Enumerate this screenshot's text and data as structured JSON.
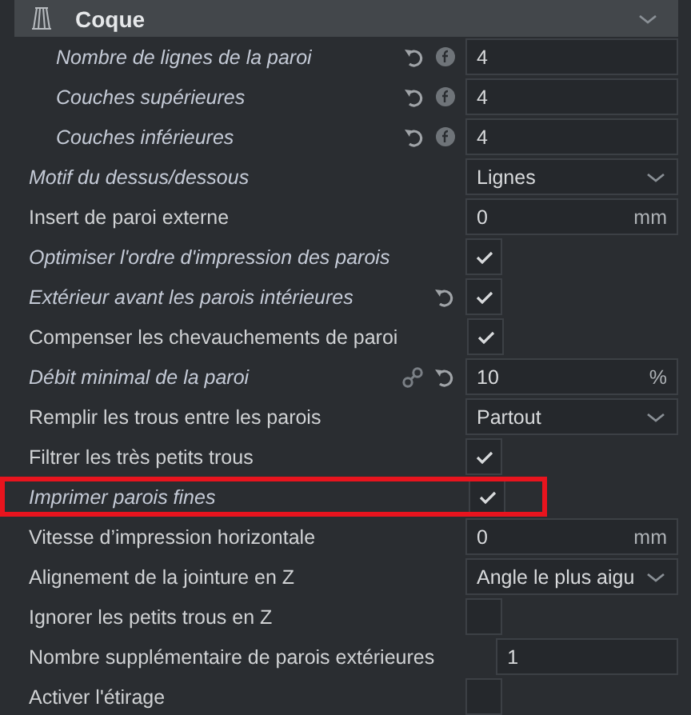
{
  "section": {
    "title": "Coque",
    "expanded": true
  },
  "rows": [
    {
      "label": "Nombre de lignes de la paroi",
      "kind": "number",
      "value": "4",
      "modified": true,
      "reset": true,
      "formula": true,
      "children": [
        {
          "label": "Couches supérieures",
          "kind": "number",
          "value": "4",
          "modified": true,
          "reset": true,
          "formula": true
        },
        {
          "label": "Couches inférieures",
          "kind": "number",
          "value": "4",
          "modified": true,
          "reset": true,
          "formula": true
        }
      ]
    },
    {
      "label": "Motif du dessus/dessous",
      "kind": "dropdown",
      "value": "Lignes",
      "modified": true
    },
    {
      "label": "Insert de paroi externe",
      "kind": "number",
      "value": "0",
      "unit": "mm",
      "modified": false
    },
    {
      "label": "Optimiser l'ordre d'impression des parois",
      "kind": "checkbox",
      "checked": true,
      "modified": true
    },
    {
      "label": "Extérieur avant les parois intérieures",
      "kind": "checkbox",
      "checked": true,
      "modified": true,
      "reset": true
    },
    {
      "label": "Compenser les chevauchements de paroi",
      "kind": "checkbox",
      "checked": true,
      "modified": false
    },
    {
      "label": "Débit minimal de la paroi",
      "kind": "number",
      "value": "10",
      "unit": "%",
      "modified": true,
      "linked": true,
      "reset": true
    },
    {
      "label": "Remplir les trous entre les parois",
      "kind": "dropdown",
      "value": "Partout",
      "modified": false
    },
    {
      "label": "Filtrer les très petits trous",
      "kind": "checkbox",
      "checked": true,
      "modified": false
    },
    {
      "label": "Imprimer parois fines",
      "kind": "checkbox",
      "checked": true,
      "modified": true,
      "highlighted": true
    },
    {
      "label": "Vitesse d’impression horizontale",
      "kind": "number",
      "value": "0",
      "unit": "mm",
      "modified": false
    },
    {
      "label": "Alignement de la jointure en Z",
      "kind": "dropdown",
      "value": "Angle le plus aigu",
      "modified": false
    },
    {
      "label": "Ignorer les petits trous en Z",
      "kind": "checkbox",
      "checked": false,
      "modified": false
    },
    {
      "label": "Nombre supplémentaire de parois extérieures",
      "kind": "number",
      "value": "1",
      "modified": false
    },
    {
      "label": "Activer l'étirage",
      "kind": "checkbox",
      "checked": false,
      "modified": false
    }
  ]
}
